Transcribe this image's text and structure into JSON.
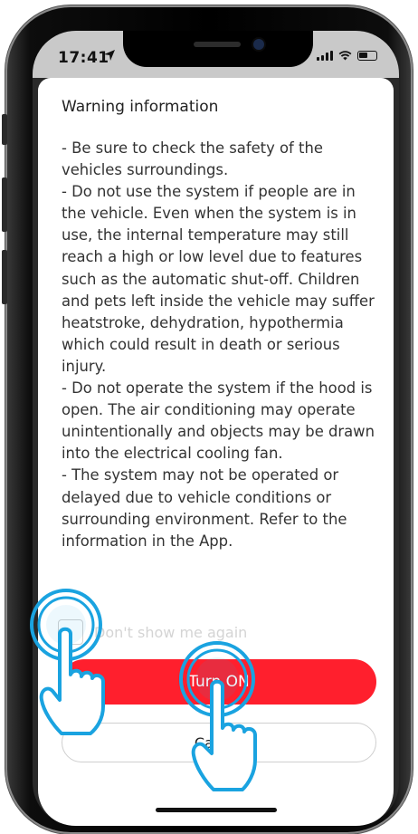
{
  "status_bar": {
    "time": "17:41"
  },
  "dialog": {
    "title": "Warning information",
    "body": "- Be sure to check the safety of the vehicles surroundings.\n- Do not use the system if people are in the vehicle. Even when the system is in use, the internal temperature may still reach a high or low level due to features such as the automatic shut-off. Children and pets left inside the vehicle may suffer heatstroke, dehydration, hypothermia which could result in death or serious injury.\n- Do not operate the system if the hood is open. The air conditioning may operate unintentionally and objects may be drawn into the electrical cooling fan.\n- The system may not be operated or delayed due to vehicle conditions or surrounding environment. Refer to the information in the App.",
    "checkbox_label": "Don't show me again",
    "primary_button": "Turn ON",
    "secondary_button": "Cancel"
  },
  "colors": {
    "primary": "#ff1f2d",
    "tap_highlight": "#1aa3e0"
  }
}
